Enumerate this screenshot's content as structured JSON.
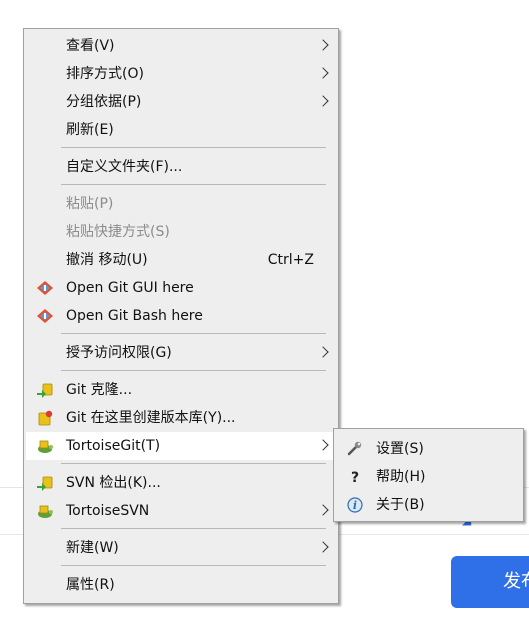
{
  "context_menu": {
    "items": [
      {
        "label": "查看(V)",
        "submenu": true
      },
      {
        "label": "排序方式(O)",
        "submenu": true
      },
      {
        "label": "分组依据(P)",
        "submenu": true
      },
      {
        "label": "刷新(E)"
      },
      {
        "label": "自定义文件夹(F)..."
      },
      {
        "label": "粘贴(P)",
        "disabled": true
      },
      {
        "label": "粘贴快捷方式(S)",
        "disabled": true
      },
      {
        "label": "撤消 移动(U)",
        "shortcut": "Ctrl+Z"
      },
      {
        "label": "Open Git GUI here",
        "icon": "git-gui-icon"
      },
      {
        "label": "Open Git Bash here",
        "icon": "git-bash-icon"
      },
      {
        "label": "授予访问权限(G)",
        "submenu": true
      },
      {
        "label": "Git 克隆...",
        "icon": "git-clone-icon"
      },
      {
        "label": "Git 在这里创建版本库(Y)...",
        "icon": "git-create-repo-icon"
      },
      {
        "label": "TortoiseGit(T)",
        "icon": "tortoisegit-icon",
        "submenu": true,
        "highlighted": true
      },
      {
        "label": "SVN 检出(K)...",
        "icon": "svn-checkout-icon"
      },
      {
        "label": "TortoiseSVN",
        "icon": "tortoisesvn-icon",
        "submenu": true
      },
      {
        "label": "新建(W)",
        "submenu": true
      },
      {
        "label": "属性(R)"
      }
    ]
  },
  "submenu": {
    "items": [
      {
        "label": "设置(S)",
        "icon": "wrench-icon"
      },
      {
        "label": "帮助(H)",
        "icon": "help-icon"
      },
      {
        "label": "关于(B)",
        "icon": "info-icon"
      }
    ]
  },
  "background": {
    "button_label": "发布"
  },
  "colors": {
    "menu_bg": "#eeeeee",
    "highlight": "#ffffff",
    "button_blue": "#2f6fe8",
    "disabled_text": "#8c8c8c"
  }
}
